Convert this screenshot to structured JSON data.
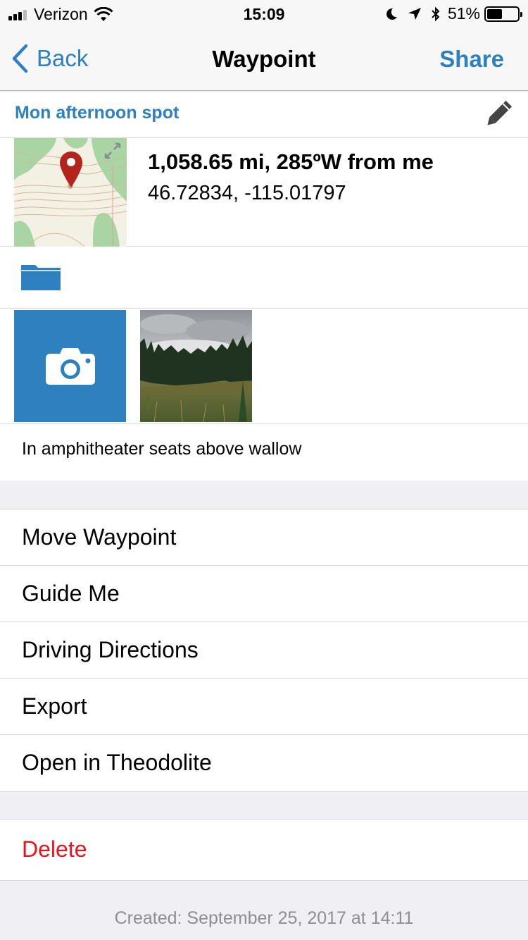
{
  "status": {
    "carrier": "Verizon",
    "time": "15:09",
    "battery": "51%",
    "battery_level": 0.51,
    "icons": [
      "signal-icon",
      "wifi-icon",
      "moon-icon",
      "location-arrow-icon",
      "bluetooth-icon",
      "battery-icon"
    ]
  },
  "nav": {
    "back_label": "Back",
    "title": "Waypoint",
    "share_label": "Share"
  },
  "waypoint": {
    "name": "Mon afternoon spot",
    "distance": "1,058.65 mi, 285ºW from me",
    "coords": "46.72834, -115.01797",
    "note": "In amphitheater seats above wallow",
    "created": "Created: September 25, 2017 at 14:11"
  },
  "actions": [
    "Move Waypoint",
    "Guide Me",
    "Driving Directions",
    "Export",
    "Open in Theodolite"
  ],
  "delete_label": "Delete",
  "colors": {
    "accent": "#2e80bf",
    "destructive": "#e8131b",
    "pin": "#b3251c"
  }
}
